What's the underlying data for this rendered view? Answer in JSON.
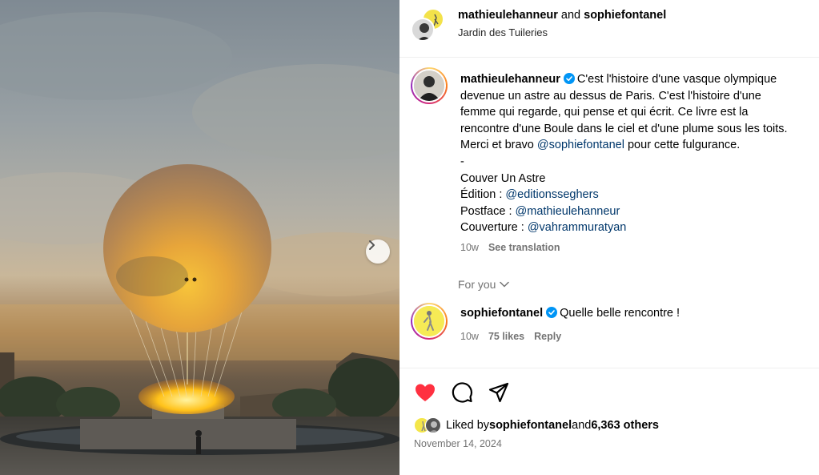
{
  "header": {
    "user1": "mathieulehanneur",
    "connector": " and ",
    "user2": "sophiefontanel",
    "location": "Jardin des Tuileries"
  },
  "caption": {
    "username": "mathieulehanneur",
    "line1": "C'est l'histoire d'une vasque olympique",
    "line2": "devenue un astre au dessus de Paris. C'est l'histoire d'une",
    "line3": "femme qui regarde, qui pense et qui écrit. Ce livre est la",
    "line4": "rencontre d'une Boule dans le ciel et d'une plume sous les toits.",
    "line5_pre": "Merci et bravo ",
    "line5_mention": "@sophiefontanel",
    "line5_post": " pour cette fulgurance.",
    "dash": "-",
    "title": "Couver Un Astre",
    "edition_label": "Édition : ",
    "edition_mention": "@editionsseghers",
    "postface_label": "Postface : ",
    "postface_mention": "@mathieulehanneur",
    "couverture_label": "Couverture : ",
    "couverture_mention": "@vahrammuratyan",
    "time": "10w",
    "see_translation": "See translation"
  },
  "for_you": "For you",
  "comment": {
    "username": "sophiefontanel",
    "text": "Quelle belle rencontre !",
    "time": "10w",
    "likes": "75 likes",
    "reply": "Reply"
  },
  "actions": {
    "like_icon": "heart-filled-icon",
    "comment_icon": "comment-icon",
    "share_icon": "share-icon",
    "like_color": "#ff3040"
  },
  "likes_summary": {
    "prefix": "Liked by ",
    "user": "sophiefontanel",
    "middle": " and ",
    "count": "6,363 others"
  },
  "date": "November 14, 2024",
  "colors": {
    "mention": "#00376b",
    "secondary": "#737373",
    "verified": "#0095f6"
  }
}
